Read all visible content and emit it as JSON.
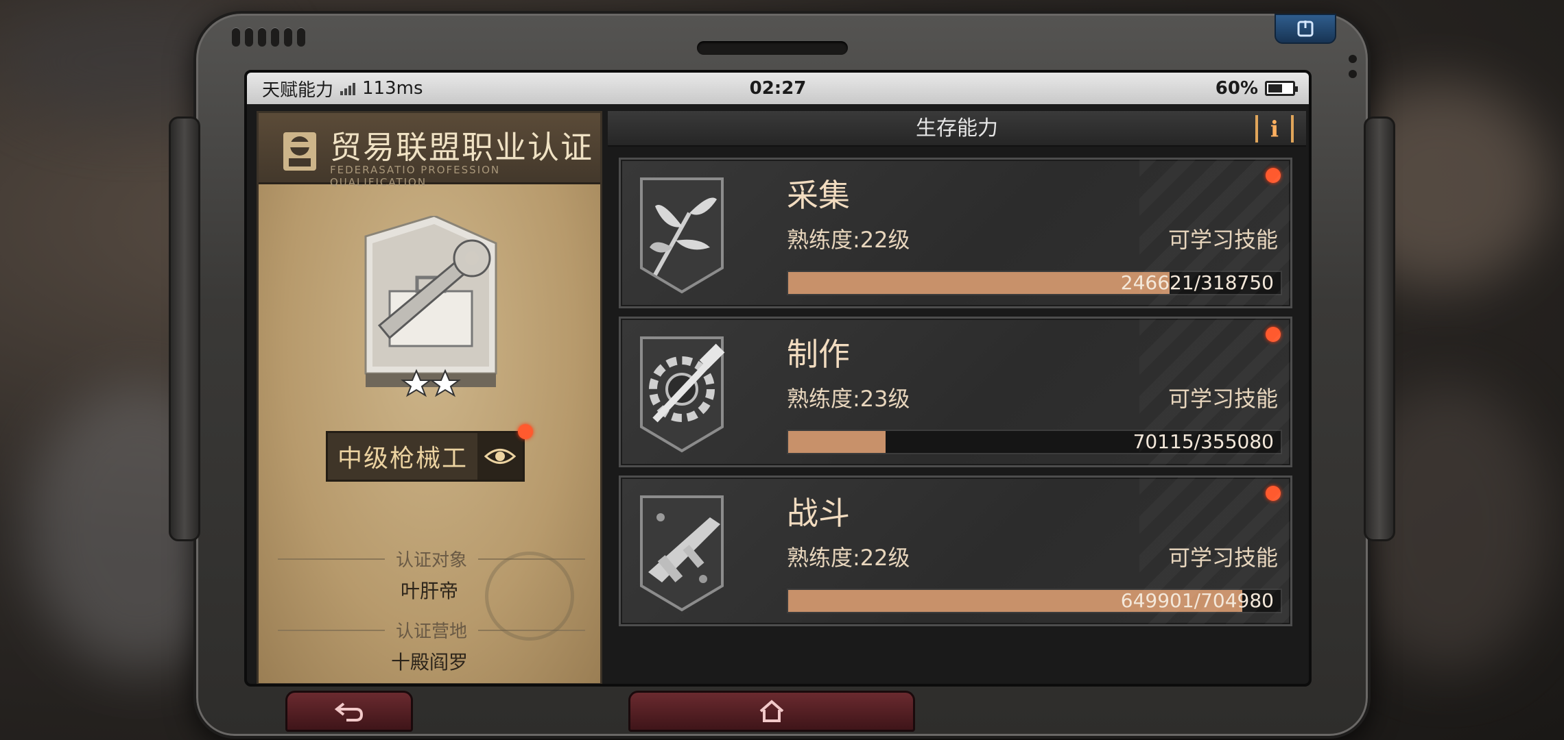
{
  "statusbar": {
    "app_label": "天赋能力",
    "ping": "113ms",
    "time": "02:27",
    "battery": "60%",
    "battery_level": 0.6
  },
  "certificate": {
    "title": "贸易联盟职业认证",
    "subtitle": "FEDERASATIO PROFESSION QUALIFICATION",
    "stars": 2,
    "rank": "中级枪械工",
    "subject_label": "认证对象",
    "subject_value": "叶肝帝",
    "camp_label": "认证营地",
    "camp_value": "十殿阎罗"
  },
  "panel": {
    "title": "生存能力",
    "info_label": "i"
  },
  "skills": [
    {
      "name": "采集",
      "level": "熟练度:22级",
      "learn": "可学习技能",
      "progress_text": "246621/318750",
      "current": 246621,
      "max": 318750,
      "icon": "leaf-icon"
    },
    {
      "name": "制作",
      "level": "熟练度:23级",
      "learn": "可学习技能",
      "progress_text": "70115/355080",
      "current": 70115,
      "max": 355080,
      "icon": "gear-hammer-icon"
    },
    {
      "name": "战斗",
      "level": "熟练度:22级",
      "learn": "可学习技能",
      "progress_text": "649901/704980",
      "current": 649901,
      "max": 704980,
      "icon": "gun-icon"
    }
  ],
  "colors": {
    "accent": "#c8916a",
    "notify": "#ff5a2e",
    "info": "#e0a55a"
  }
}
